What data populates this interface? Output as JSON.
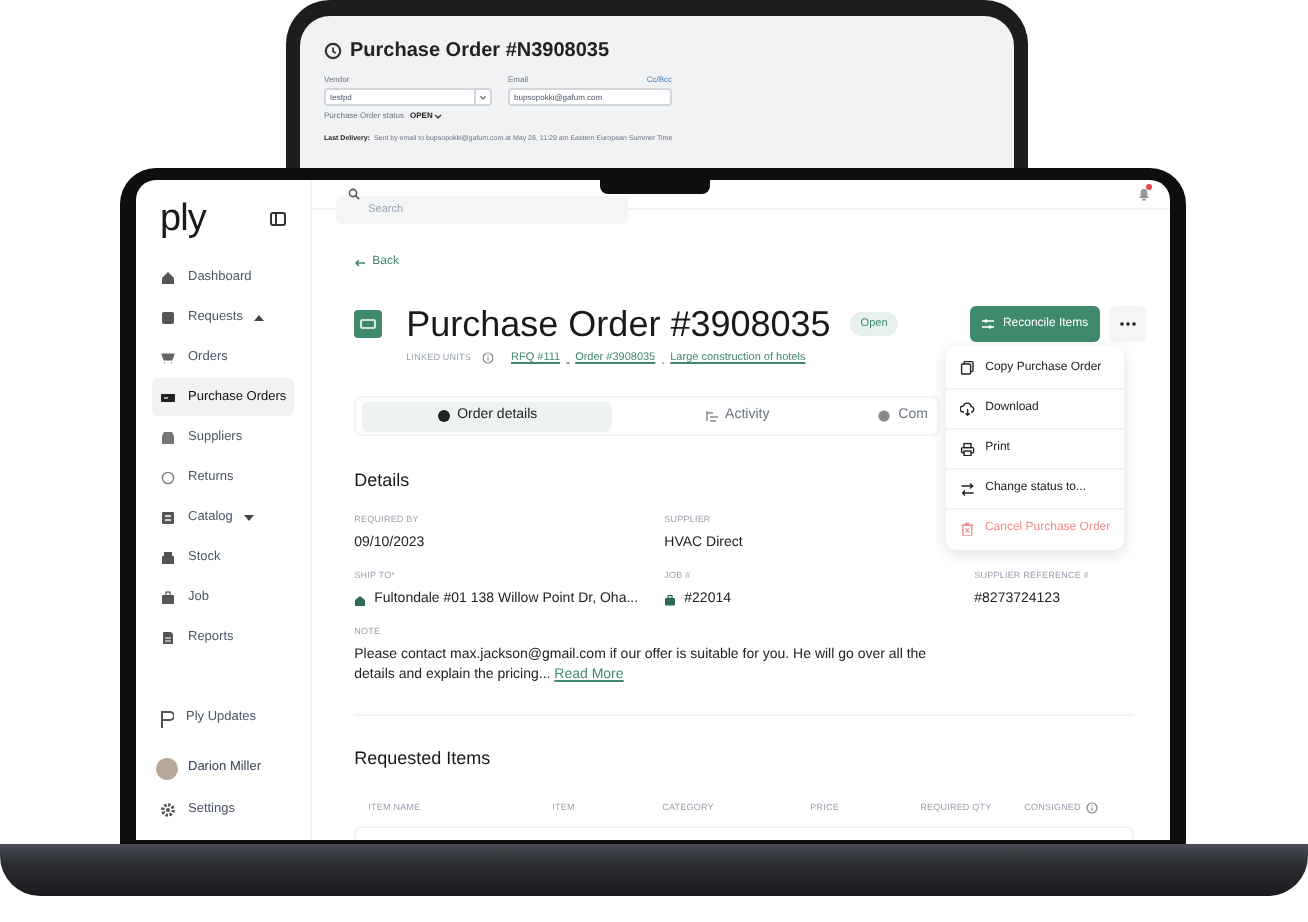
{
  "tablet": {
    "title": "Purchase Order #N3908035",
    "vendor_label": "Vendor",
    "vendor_value": "testpd",
    "email_label": "Email",
    "email_link": "Cc/Bcc",
    "email_value": "bupsopokki@gafum.com",
    "status_label": "Purchase Order status",
    "status_value": "OPEN",
    "last_delivery_label": "Last Delivery:",
    "last_delivery_text": "Sent by email to bupsopokki@gafum.com at May 28, 11:29 am Eastern European Summer Time"
  },
  "sidebar": {
    "logo": "ply",
    "items": [
      {
        "label": "Dashboard",
        "selected": false
      },
      {
        "label": "Requests",
        "selected": false,
        "expanded": true,
        "children": [
          {
            "label": "Orders",
            "selected": false
          },
          {
            "label": "Purchase Orders",
            "selected": true
          },
          {
            "label": "Suppliers",
            "selected": false
          },
          {
            "label": "Returns",
            "selected": false
          }
        ]
      },
      {
        "label": "Catalog",
        "selected": false,
        "expanded": false
      },
      {
        "label": "Stock",
        "selected": false
      },
      {
        "label": "Job",
        "selected": false
      },
      {
        "label": "Reports",
        "selected": false
      }
    ],
    "updates": "Ply Updates",
    "user": "Darion Miller",
    "settings": "Settings"
  },
  "topbar": {
    "search_placeholder": "Search",
    "has_notification": true
  },
  "header": {
    "back": "Back",
    "title": "Purchase Order #3908035",
    "status": "Open",
    "linked_units_label": "LINKED UNITS",
    "links": [
      "RFQ #111",
      "Order #3908035",
      "Large construction of hotels"
    ],
    "primary_button": "Reconcile Items"
  },
  "menu": [
    {
      "label": "Copy Purchase Order",
      "kind": "copy"
    },
    {
      "label": "Download",
      "kind": "download"
    },
    {
      "label": "Print",
      "kind": "print"
    },
    {
      "label": "Change status to...",
      "kind": "status"
    },
    {
      "label": "Cancel Purchase Order",
      "kind": "danger"
    }
  ],
  "tabs": [
    {
      "label": "Order details",
      "selected": true
    },
    {
      "label": "Activity",
      "selected": false
    },
    {
      "label": "Com",
      "selected": false
    }
  ],
  "details": {
    "heading": "Details",
    "rows": [
      [
        {
          "label": "REQUIRED BY",
          "value": "09/10/2023"
        },
        {
          "label": "SUPPLIER",
          "value": "HVAC Direct"
        },
        null
      ],
      [
        {
          "label": "SHIP TO*",
          "value": "Fultondale #01 138 Willow Point Dr, Oha...",
          "kind": "location"
        },
        {
          "label": "JOB #",
          "value": "#22014",
          "kind": "job"
        },
        {
          "label": "SUPPLIER REFERENCE #",
          "value": "#8273724123"
        }
      ]
    ],
    "note_label": "NOTE",
    "note": "Please contact max.jackson@gmail.com if our offer is suitable for you. He will go over all the details and explain the pricing...",
    "read_more": "Read More"
  },
  "requested_items": {
    "heading": "Requested Items",
    "columns": [
      "ITEM NAME",
      "ITEM",
      "CATEGORY",
      "PRICE",
      "REQUIRED QTY",
      "CONSIGNED"
    ]
  }
}
